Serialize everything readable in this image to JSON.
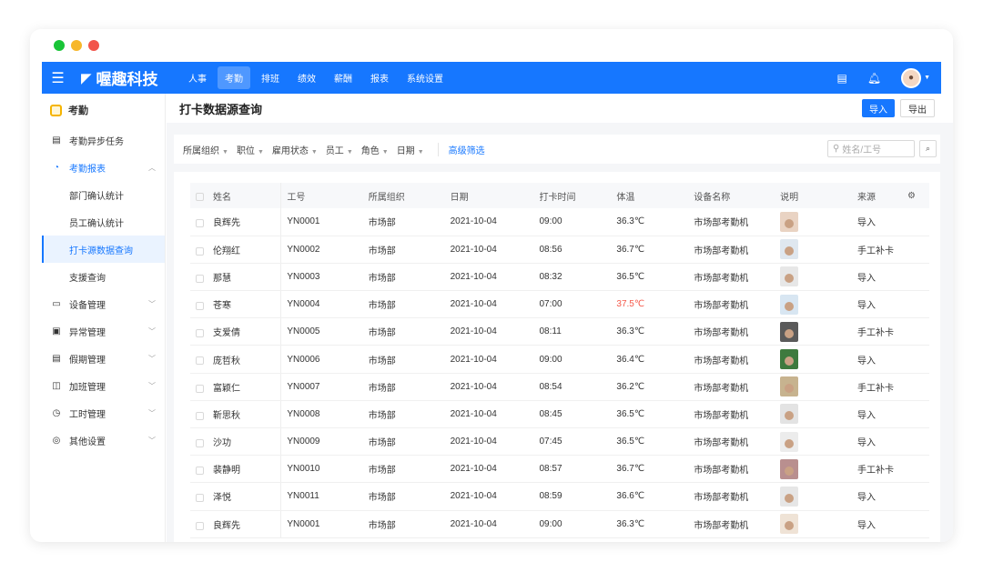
{
  "window": {
    "dots": [
      "#19c437",
      "#f7b72a",
      "#f2544b"
    ]
  },
  "topnav": {
    "brand": "喔趣科技",
    "menu": [
      {
        "label": "人事",
        "active": false
      },
      {
        "label": "考勤",
        "active": true
      },
      {
        "label": "排班",
        "active": false
      },
      {
        "label": "绩效",
        "active": false
      },
      {
        "label": "薪酬",
        "active": false
      },
      {
        "label": "报表",
        "active": false
      },
      {
        "label": "系统设置",
        "active": false
      }
    ]
  },
  "sidebar": {
    "header": "考勤",
    "items": [
      {
        "label": "考勤异步任务",
        "icon": "list-icon",
        "type": "item"
      },
      {
        "label": "考勤报表",
        "icon": "chart-icon",
        "type": "group-open"
      },
      {
        "label": "部门确认统计",
        "type": "sub"
      },
      {
        "label": "员工确认统计",
        "type": "sub"
      },
      {
        "label": "打卡源数据查询",
        "type": "sub-active"
      },
      {
        "label": "支援查询",
        "type": "sub"
      },
      {
        "label": "设备管理",
        "icon": "device-icon",
        "type": "group"
      },
      {
        "label": "异常管理",
        "icon": "alert-icon",
        "type": "group"
      },
      {
        "label": "假期管理",
        "icon": "calendar-icon",
        "type": "group"
      },
      {
        "label": "加班管理",
        "icon": "overtime-icon",
        "type": "group"
      },
      {
        "label": "工时管理",
        "icon": "clock-icon",
        "type": "group"
      },
      {
        "label": "其他设置",
        "icon": "settings-icon",
        "type": "group"
      }
    ]
  },
  "page": {
    "title": "打卡数据源查询",
    "import_label": "导入",
    "export_label": "导出"
  },
  "filters": {
    "items": [
      "所属组织",
      "职位",
      "雇用状态",
      "员工",
      "角色",
      "日期"
    ],
    "advanced": "高级筛选",
    "search_placeholder": "姓名/工号"
  },
  "table": {
    "headers": [
      "姓名",
      "工号",
      "所属组织",
      "日期",
      "打卡时间",
      "体温",
      "设备名称",
      "说明",
      "来源"
    ],
    "rows": [
      {
        "name": "良辉先",
        "id": "YN0001",
        "org": "市场部",
        "date": "2021-10-04",
        "time": "09:00",
        "temp": "36.3℃",
        "device": "市场部考勤机",
        "source": "导入",
        "warn": false,
        "photo": "#e9d3c3"
      },
      {
        "name": "伦翔红",
        "id": "YN0002",
        "org": "市场部",
        "date": "2021-10-04",
        "time": "08:56",
        "temp": "36.7℃",
        "device": "市场部考勤机",
        "source": "手工补卡",
        "warn": false,
        "photo": "#dfe7ef"
      },
      {
        "name": "那慧",
        "id": "YN0003",
        "org": "市场部",
        "date": "2021-10-04",
        "time": "08:32",
        "temp": "36.5℃",
        "device": "市场部考勤机",
        "source": "导入",
        "warn": false,
        "photo": "#e7e7e7"
      },
      {
        "name": "苍寒",
        "id": "YN0004",
        "org": "市场部",
        "date": "2021-10-04",
        "time": "07:00",
        "temp": "37.5℃",
        "device": "市场部考勤机",
        "source": "导入",
        "warn": true,
        "photo": "#d8e6f2"
      },
      {
        "name": "支爱倩",
        "id": "YN0005",
        "org": "市场部",
        "date": "2021-10-04",
        "time": "08:11",
        "temp": "36.3℃",
        "device": "市场部考勤机",
        "source": "手工补卡",
        "warn": false,
        "photo": "#5a5a5a"
      },
      {
        "name": "庞哲秋",
        "id": "YN0006",
        "org": "市场部",
        "date": "2021-10-04",
        "time": "09:00",
        "temp": "36.4℃",
        "device": "市场部考勤机",
        "source": "导入",
        "warn": false,
        "photo": "#3e7a3e"
      },
      {
        "name": "富颖仁",
        "id": "YN0007",
        "org": "市场部",
        "date": "2021-10-04",
        "time": "08:54",
        "temp": "36.2℃",
        "device": "市场部考勤机",
        "source": "手工补卡",
        "warn": false,
        "photo": "#c7b38f"
      },
      {
        "name": "靳思秋",
        "id": "YN0008",
        "org": "市场部",
        "date": "2021-10-04",
        "time": "08:45",
        "temp": "36.5℃",
        "device": "市场部考勤机",
        "source": "导入",
        "warn": false,
        "photo": "#e3e3e3"
      },
      {
        "name": "沙功",
        "id": "YN0009",
        "org": "市场部",
        "date": "2021-10-04",
        "time": "07:45",
        "temp": "36.5℃",
        "device": "市场部考勤机",
        "source": "导入",
        "warn": false,
        "photo": "#ececec"
      },
      {
        "name": "裴静明",
        "id": "YN0010",
        "org": "市场部",
        "date": "2021-10-04",
        "time": "08:57",
        "temp": "36.7℃",
        "device": "市场部考勤机",
        "source": "手工补卡",
        "warn": false,
        "photo": "#b98f8f"
      },
      {
        "name": "泽悦",
        "id": "YN0011",
        "org": "市场部",
        "date": "2021-10-04",
        "time": "08:59",
        "temp": "36.6℃",
        "device": "市场部考勤机",
        "source": "导入",
        "warn": false,
        "photo": "#e6e6e6"
      },
      {
        "name": "良辉先",
        "id": "YN0001",
        "org": "市场部",
        "date": "2021-10-04",
        "time": "09:00",
        "temp": "36.3℃",
        "device": "市场部考勤机",
        "source": "导入",
        "warn": false,
        "photo": "#efe3d6"
      }
    ]
  }
}
